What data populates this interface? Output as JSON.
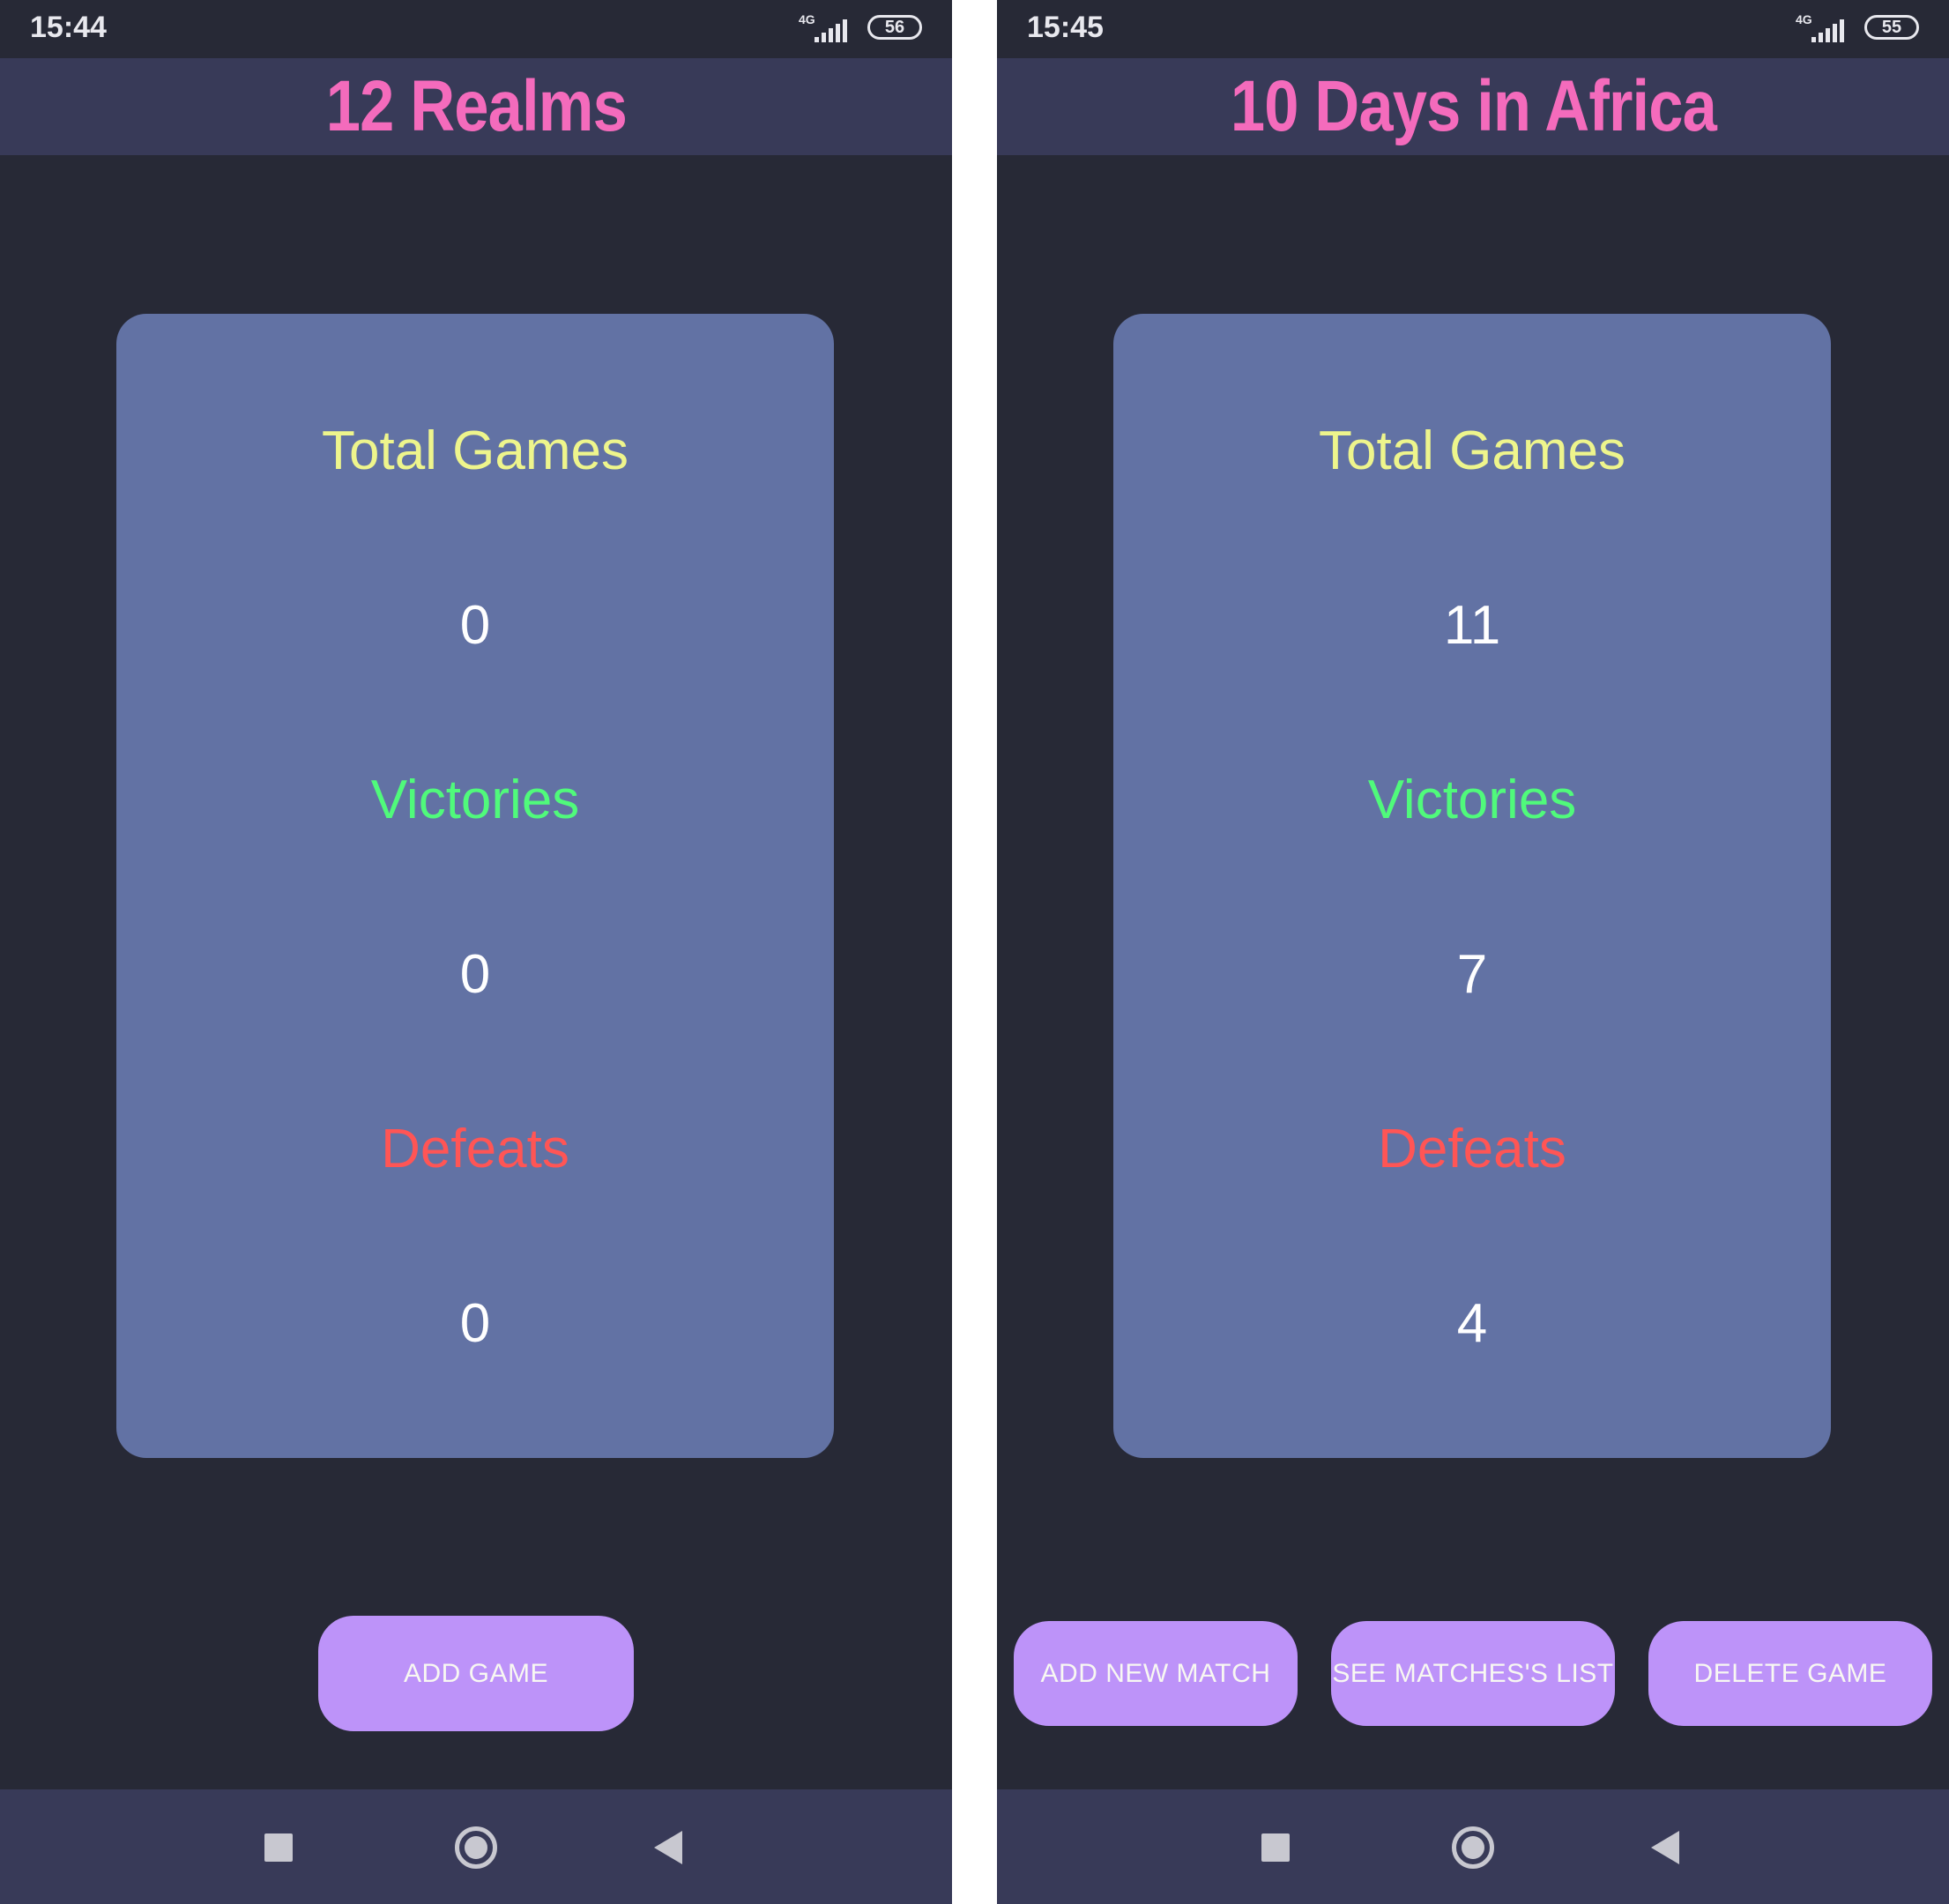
{
  "screens": [
    {
      "status": {
        "time": "15:44",
        "network": "4G",
        "battery": "56"
      },
      "title": "12 Realms",
      "stats": {
        "total_label": "Total Games",
        "total_value": "0",
        "victories_label": "Victories",
        "victories_value": "0",
        "defeats_label": "Defeats",
        "defeats_value": "0"
      },
      "buttons": [
        "ADD GAME"
      ]
    },
    {
      "status": {
        "time": "15:45",
        "network": "4G",
        "battery": "55"
      },
      "title": "10 Days in Africa",
      "stats": {
        "total_label": "Total Games",
        "total_value": "11",
        "victories_label": "Victories",
        "victories_value": "7",
        "defeats_label": "Defeats",
        "defeats_value": "4"
      },
      "buttons": [
        "ADD NEW MATCH",
        "SEE MATCHES'S LIST",
        "DELETE GAME"
      ]
    }
  ],
  "colors": {
    "background": "#272936",
    "app_bar": "#383a58",
    "title": "#f46bbc",
    "card": "#6272a4",
    "total_label": "#eef58c",
    "victories_label": "#50fa7b",
    "defeats_label": "#ff5555",
    "button": "#bd93f9"
  }
}
